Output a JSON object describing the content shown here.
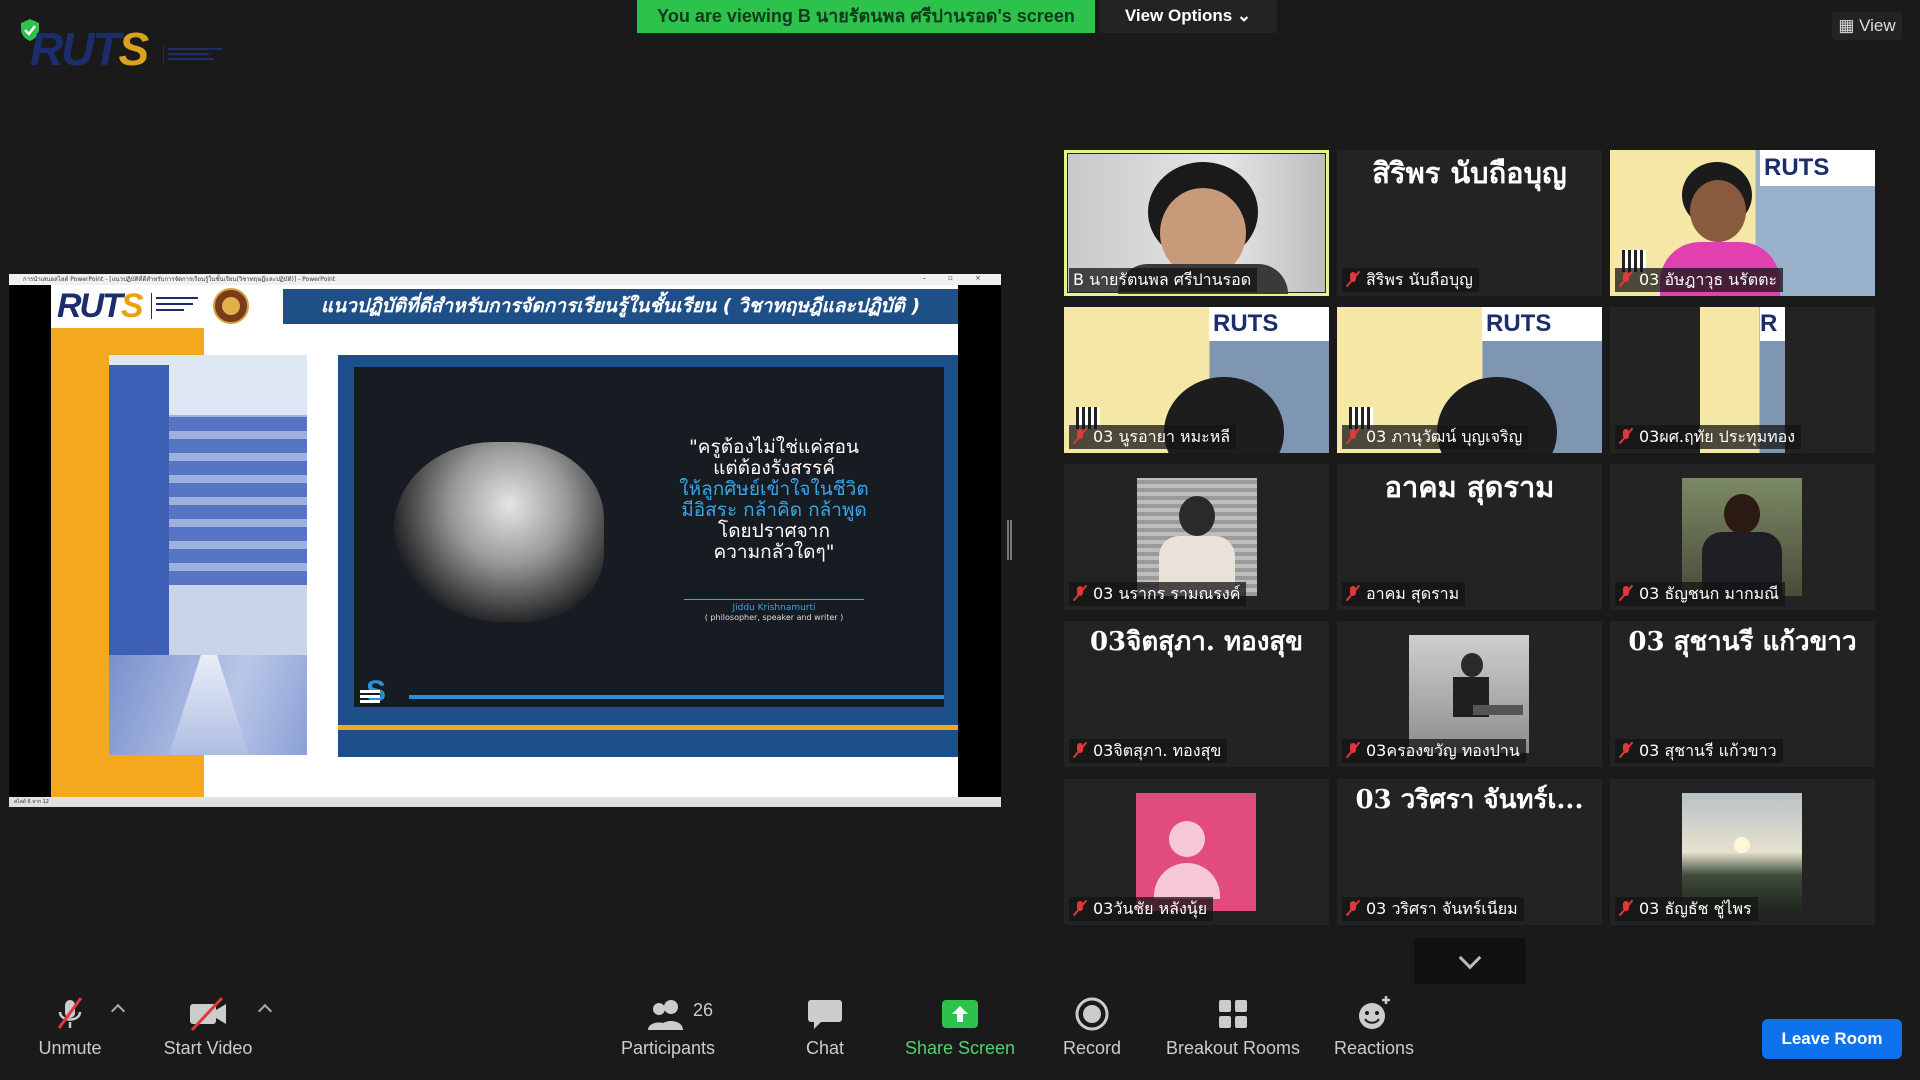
{
  "banner": {
    "text": "You are viewing B นายรัตนพล ศรีปานรอด's screen",
    "view_options": "View Options ⌄"
  },
  "top_logo": {
    "rut": "RUT",
    "s": "S"
  },
  "view_button": "▦ View",
  "shared_slide": {
    "app_title": "การนำเสนอสไลด์ PowerPoint - [แนวปฏิบัติที่ดีสำหรับการจัดการเรียนรู้ในชั้นเรียน(วิชาทฤษฎีและปฏิบัติ)] - PowerPoint",
    "window_controls": "– ▫ ×",
    "status": "สไลด์ 6 จาก 12",
    "logo_rut": "RUT",
    "logo_s": "S",
    "title": "แนวปฏิบัติที่ดีสำหรับการจัดการเรียนรู้ในชั้นเรียน ( วิชาทฤษฎีและปฏิบัติ )",
    "quote_line1": "\"ครูต้องไม่ใช่แค่สอน",
    "quote_line2": "แต่ต้องรังสรรค์",
    "quote_line3": "ให้ลูกศิษย์เข้าใจในชีวิต",
    "quote_line4": "มีอิสระ กล้าคิด กล้าพูด",
    "quote_line5": "โดยปราศจาก",
    "quote_line6": "ความกลัวใดๆ\"",
    "author": "Jiddu Krishnamurti",
    "author_role": "( philosopher, speaker and writer )",
    "icon_letter": "S"
  },
  "participants_tiles": [
    {
      "label": "B นายรัตนพล ศรีปานรอด",
      "big": "",
      "muted": false,
      "kind": "video-boy"
    },
    {
      "label": "สิริพร นับถือบุญ",
      "big": "สิริพร นับถือบุญ",
      "muted": true,
      "kind": "name"
    },
    {
      "label": "03 อัษฎาวุธ  นรัตตะ",
      "big": "",
      "muted": true,
      "kind": "video-boy2"
    },
    {
      "label": "03 นูรอายา หมะหลี",
      "big": "",
      "muted": true,
      "kind": "video-slide"
    },
    {
      "label": "03 ภานุวัฒน์ บุญเจริญ",
      "big": "",
      "muted": true,
      "kind": "video-slide"
    },
    {
      "label": "03ผศ.ฤทัย ประทุมทอง",
      "big": "",
      "muted": true,
      "kind": "video-slide-narrow"
    },
    {
      "label": "03 นรากร รามณรงค์",
      "big": "",
      "muted": true,
      "kind": "video-mask"
    },
    {
      "label": "อาคม สุดราม",
      "big": "อาคม สุดราม",
      "muted": true,
      "kind": "name"
    },
    {
      "label": "03 ธัญชนก มากมณี",
      "big": "",
      "muted": true,
      "kind": "video-sit"
    },
    {
      "label": "03จิตสุภา. ทองสุข",
      "big": "03จิตสุภา. ทองสุข",
      "muted": true,
      "kind": "name"
    },
    {
      "label": "03ครองขวัญ ทองปาน",
      "big": "",
      "muted": true,
      "kind": "video-bench"
    },
    {
      "label": "03 สุชานรี แก้วขาว",
      "big": "03 สุชานรี แก้วขาว",
      "muted": true,
      "kind": "name"
    },
    {
      "label": "03วันชัย หลังนุ้ย",
      "big": "",
      "muted": true,
      "kind": "avatar"
    },
    {
      "label": "03 วริศรา จันทร์เนียม",
      "big": "03 วริศรา จันทร์เ...",
      "muted": true,
      "kind": "name"
    },
    {
      "label": "03 ธัญธัช  ชู่ไพร",
      "big": "",
      "muted": true,
      "kind": "video-sunset"
    }
  ],
  "toolbar": {
    "unmute": "Unmute",
    "start_video": "Start Video",
    "participants": "Participants",
    "participants_count": "26",
    "chat": "Chat",
    "share_screen": "Share Screen",
    "record": "Record",
    "breakout_rooms": "Breakout Rooms",
    "reactions": "Reactions",
    "leave": "Leave Room"
  },
  "colors": {
    "active_speaker": "#e6f58b",
    "banner_green": "#2dc24c",
    "leave_blue": "#0e72ed",
    "share_green": "#4fd36a",
    "muted_red": "#e0383a"
  }
}
